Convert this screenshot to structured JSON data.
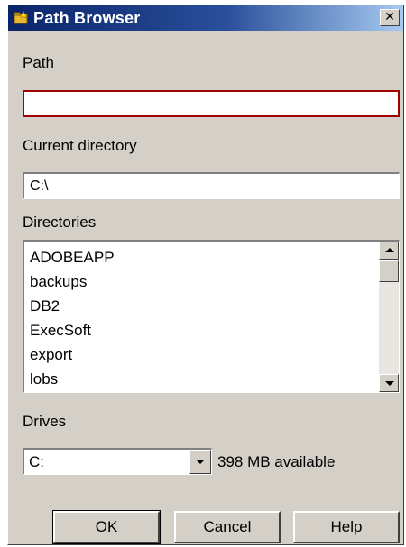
{
  "window": {
    "title": "Path Browser",
    "icon": "folder-icon",
    "close_glyph": "✕"
  },
  "path": {
    "label": "Path",
    "value": ""
  },
  "current_directory": {
    "label": "Current directory",
    "value": "C:\\"
  },
  "directories": {
    "label": "Directories",
    "items": [
      "ADOBEAPP",
      "backups",
      "DB2",
      "ExecSoft",
      "export",
      "lobs"
    ]
  },
  "drives": {
    "label": "Drives",
    "selected": "C:",
    "available": "398 MB available"
  },
  "buttons": {
    "ok": "OK",
    "cancel": "Cancel",
    "help": "Help"
  },
  "colors": {
    "titlebar_start": "#0a246a",
    "titlebar_end": "#a6caf0",
    "focus_border": "#a00000",
    "dialog_bg": "#d4d0c8"
  }
}
